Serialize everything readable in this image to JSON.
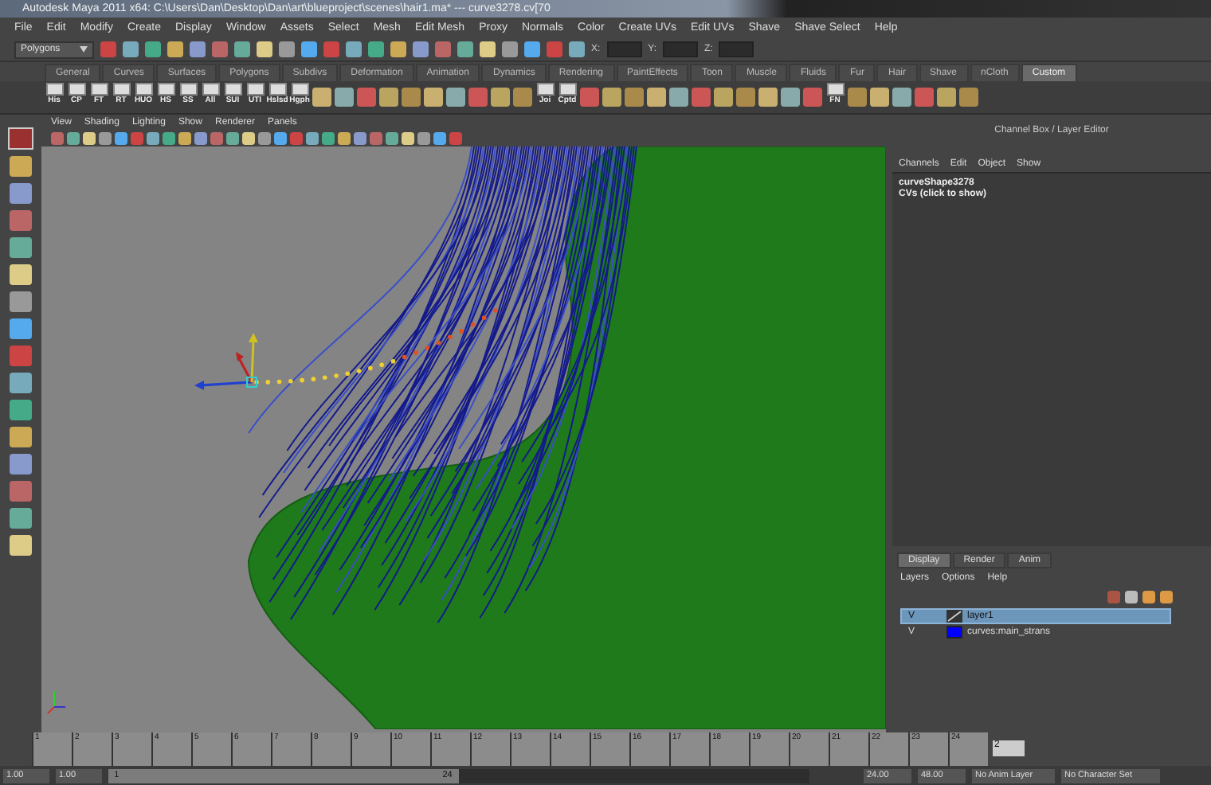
{
  "window": {
    "title": "Autodesk Maya 2011 x64: C:\\Users\\Dan\\Desktop\\Dan\\art\\blueproject\\scenes\\hair1.ma*  ---  curve3278.cv[70"
  },
  "menu": [
    "File",
    "Edit",
    "Modify",
    "Create",
    "Display",
    "Window",
    "Assets",
    "Select",
    "Mesh",
    "Edit Mesh",
    "Proxy",
    "Normals",
    "Color",
    "Create UVs",
    "Edit UVs",
    "Shave",
    "Shave Select",
    "Help"
  ],
  "status_line": {
    "mode": "Polygons",
    "coords": [
      "X:",
      "Y:",
      "Z:"
    ]
  },
  "shelf_tabs": [
    {
      "label": "General",
      "selected": false
    },
    {
      "label": "Curves",
      "selected": false
    },
    {
      "label": "Surfaces",
      "selected": false
    },
    {
      "label": "Polygons",
      "selected": false
    },
    {
      "label": "Subdivs",
      "selected": false
    },
    {
      "label": "Deformation",
      "selected": false
    },
    {
      "label": "Animation",
      "selected": false
    },
    {
      "label": "Dynamics",
      "selected": false
    },
    {
      "label": "Rendering",
      "selected": false
    },
    {
      "label": "PaintEffects",
      "selected": false
    },
    {
      "label": "Toon",
      "selected": false
    },
    {
      "label": "Muscle",
      "selected": false
    },
    {
      "label": "Fluids",
      "selected": false
    },
    {
      "label": "Fur",
      "selected": false
    },
    {
      "label": "Hair",
      "selected": false
    },
    {
      "label": "Shave",
      "selected": false
    },
    {
      "label": "nCloth",
      "selected": false
    },
    {
      "label": "Custom",
      "selected": true
    }
  ],
  "shelf": [
    {
      "kind": "labeled",
      "label": "His"
    },
    {
      "kind": "labeled",
      "label": "CP"
    },
    {
      "kind": "labeled",
      "label": "FT"
    },
    {
      "kind": "labeled",
      "label": "RT"
    },
    {
      "kind": "labeled",
      "label": "HUO"
    },
    {
      "kind": "labeled",
      "label": "HS"
    },
    {
      "kind": "labeled",
      "label": "SS"
    },
    {
      "kind": "labeled",
      "label": "All"
    },
    {
      "kind": "labeled",
      "label": "SUI"
    },
    {
      "kind": "labeled",
      "label": "UTI"
    },
    {
      "kind": "labeled",
      "label": "Hslsd"
    },
    {
      "kind": "labeled",
      "label": "Hgph"
    },
    {
      "kind": "icon"
    },
    {
      "kind": "icon"
    },
    {
      "kind": "icon"
    },
    {
      "kind": "icon"
    },
    {
      "kind": "icon"
    },
    {
      "kind": "icon"
    },
    {
      "kind": "icon"
    },
    {
      "kind": "icon"
    },
    {
      "kind": "icon"
    },
    {
      "kind": "icon"
    },
    {
      "kind": "labeled",
      "label": "Joi"
    },
    {
      "kind": "labeled",
      "label": "Cptd"
    },
    {
      "kind": "icon"
    },
    {
      "kind": "icon"
    },
    {
      "kind": "icon"
    },
    {
      "kind": "icon"
    },
    {
      "kind": "icon"
    },
    {
      "kind": "icon"
    },
    {
      "kind": "icon"
    },
    {
      "kind": "icon"
    },
    {
      "kind": "icon"
    },
    {
      "kind": "icon"
    },
    {
      "kind": "icon"
    },
    {
      "kind": "labeled",
      "label": "FN"
    },
    {
      "kind": "icon"
    },
    {
      "kind": "icon"
    },
    {
      "kind": "icon"
    },
    {
      "kind": "icon"
    },
    {
      "kind": "icon"
    },
    {
      "kind": "icon"
    }
  ],
  "viewport": {
    "menu": [
      "View",
      "Shading",
      "Lighting",
      "Show",
      "Renderer",
      "Panels"
    ]
  },
  "channel_box": {
    "title": "Channel Box / Layer Editor",
    "menu": [
      "Channels",
      "Edit",
      "Object",
      "Show"
    ],
    "object": "curveShape3278",
    "cvs": "CVs (click to show)"
  },
  "layer_editor": {
    "tabs": [
      {
        "label": "Display",
        "selected": true
      },
      {
        "label": "Render",
        "selected": false
      },
      {
        "label": "Anim",
        "selected": false
      }
    ],
    "menu": [
      "Layers",
      "Options",
      "Help"
    ],
    "layers": [
      {
        "visible": "V",
        "name": "layer1",
        "selected": true
      },
      {
        "visible": "V",
        "name": "curves:main_strans",
        "selected": false,
        "color": "#0000ff"
      }
    ]
  },
  "time_slider": {
    "ticks": [
      "1",
      "2",
      "3",
      "4",
      "5",
      "6",
      "7",
      "8",
      "9",
      "10",
      "11",
      "12",
      "13",
      "14",
      "15",
      "16",
      "17",
      "18",
      "19",
      "20",
      "21",
      "22",
      "23",
      "24"
    ],
    "current": "2"
  },
  "range_slider": {
    "level": 0.5,
    "start": "1.00",
    "playback_start": "1.00",
    "range_start": "1",
    "range_end": "24",
    "playback_end": "24.00",
    "end": "48.00",
    "anim_layer": "No Anim Layer",
    "character_set": "No Character Set"
  }
}
